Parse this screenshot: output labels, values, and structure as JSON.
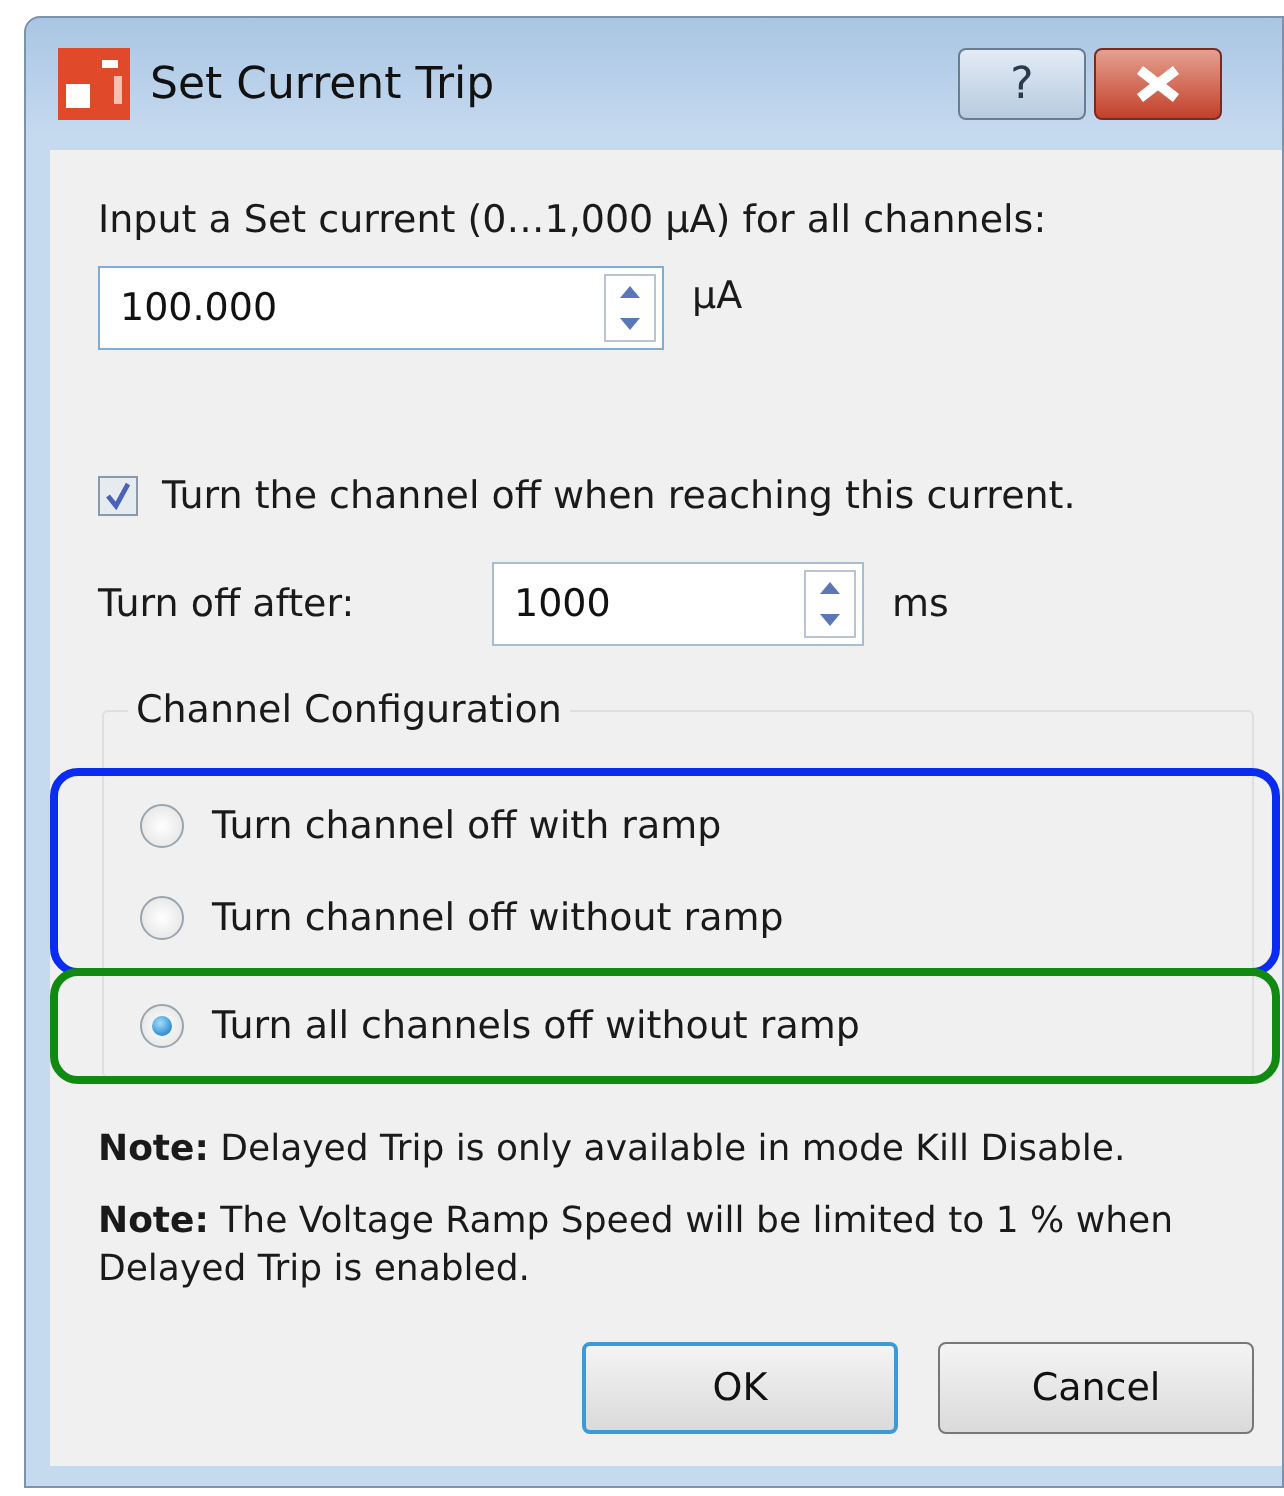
{
  "window": {
    "title": "Set Current Trip",
    "buttons": [
      {
        "kind": "help",
        "label": "?"
      },
      {
        "kind": "close"
      }
    ]
  },
  "current": {
    "label": "Input a Set current (0…1,000 µA) for all channels:",
    "value": "100.000",
    "unit": "µA"
  },
  "trip_checkbox": {
    "label": "Turn the channel off when reaching this current.",
    "checked": true
  },
  "delay": {
    "label": "Turn off after:",
    "value": "1000",
    "unit": "ms"
  },
  "channel_configuration": {
    "title": "Channel Configuration",
    "option_groups": [
      {
        "color": "#0a2bf0",
        "options": [
          {
            "label": "Turn channel off with ramp",
            "selected": false
          },
          {
            "label": "Turn channel off without ramp",
            "selected": false
          }
        ]
      },
      {
        "color": "#108a10",
        "options": [
          {
            "label": "Turn all channels off without ramp",
            "selected": true
          }
        ]
      }
    ]
  },
  "notes": [
    "**Note:** Delayed Trip is only available in mode Kill Disable.",
    "**Note:** The Voltage Ramp Speed will be limited to 1 % when Delayed Trip is enabled."
  ],
  "buttons": [
    {
      "label": "OK",
      "default": true
    },
    {
      "label": "Cancel",
      "default": false
    }
  ]
}
